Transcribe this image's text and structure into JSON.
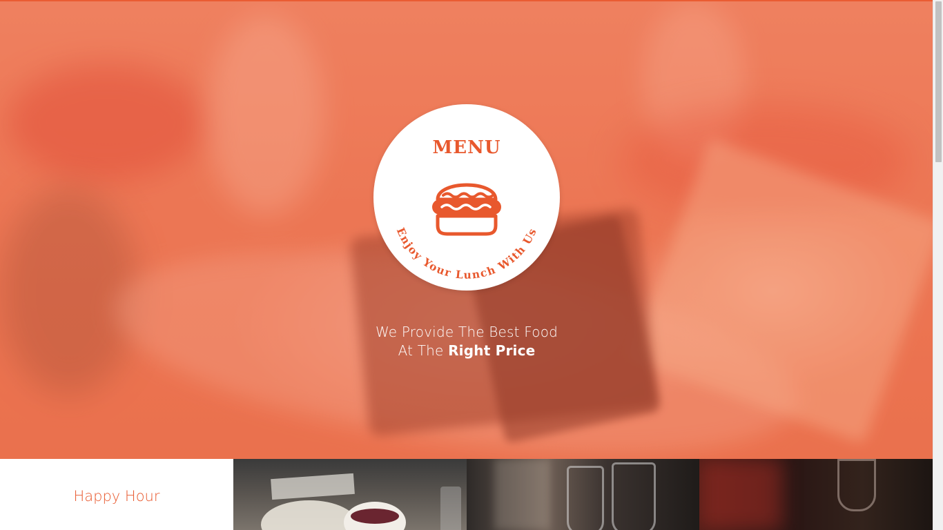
{
  "hero": {
    "logo": {
      "title": "MENU",
      "arc_text": "Enjoy Your Lunch With Us",
      "icon": "burger-icon"
    },
    "tagline": {
      "line1": "We Provide The Best Food",
      "line2_prefix": "At The",
      "line2_emphasis": "Right Price"
    }
  },
  "strip": {
    "tiles": [
      {
        "label": "Happy Hour"
      },
      {
        "image": "table-setting-photo"
      },
      {
        "image": "wine-glasses-photo"
      },
      {
        "image": "red-wine-photo"
      }
    ]
  },
  "colors": {
    "accent": "#e8582d",
    "hero_overlay": "#ee6e4b",
    "white": "#ffffff"
  },
  "scrollbar": {
    "position_fraction": 0.0
  }
}
